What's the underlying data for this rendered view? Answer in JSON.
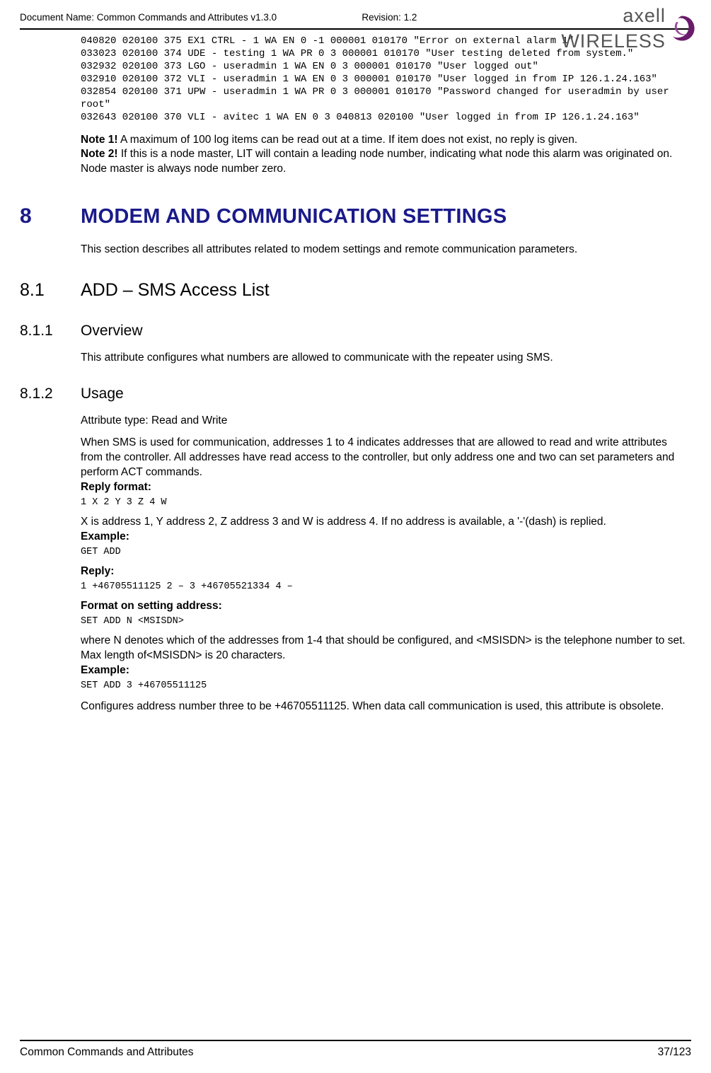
{
  "header": {
    "doc_name": "Document Name: Common Commands and Attributes v1.3.0",
    "revision": "Revision: 1.2",
    "logo_brand": "axell",
    "logo_sub": "WIRELESS"
  },
  "code_block": "040820 020100 375 EX1 CTRL - 1 WA EN 0 -1 000001 010170 \"Error on external alarm 1\"\n033023 020100 374 UDE - testing 1 WA PR 0 3 000001 010170 \"User testing deleted from system.\"\n032932 020100 373 LGO - useradmin 1 WA EN 0 3 000001 010170 \"User logged out\"\n032910 020100 372 VLI - useradmin 1 WA EN 0 3 000001 010170 \"User logged in from IP 126.1.24.163\"\n032854 020100 371 UPW - useradmin 1 WA PR 0 3 000001 010170 \"Password changed for useradmin by user root\"\n032643 020100 370 VLI - avitec 1 WA EN 0 3 040813 020100 \"User logged in from IP 126.1.24.163\"",
  "notes": {
    "note1_label": "Note 1!",
    "note1_text": " A maximum of 100 log items can be read out at a time. If item does not exist, no reply is given.",
    "note2_label": "Note 2!",
    "note2_text": " If this is a  node master, LIT will contain a leading node number, indicating what node this alarm was originated on. Node master is always node number zero."
  },
  "h1": {
    "num": "8",
    "text": "MODEM AND COMMUNICATION SETTINGS"
  },
  "h1_intro": "This section describes all attributes related to modem settings and remote communication  parameters.",
  "h2": {
    "num": "8.1",
    "text": "ADD – SMS Access List"
  },
  "h3a": {
    "num": "8.1.1",
    "text": "Overview"
  },
  "overview_text": "This attribute configures what numbers are allowed to communicate with the repeater using SMS.",
  "h3b": {
    "num": "8.1.2",
    "text": "Usage"
  },
  "usage": {
    "attr_type": "Attribute type: Read and Write",
    "intro": "When SMS is used for communication, addresses 1 to 4 indicates addresses that are allowed to read and write attributes from the controller. All addresses have read access to the controller, but only address one and two can set parameters and perform ACT commands.",
    "reply_format_label": "Reply format:",
    "reply_format_code": "1 X 2 Y 3 Z 4 W",
    "reply_format_expl": "X is address 1, Y address 2, Z address 3 and W is address 4. If no address is available, a '-'(dash) is replied.",
    "example_label": "Example:",
    "example_code": "GET ADD",
    "reply_label": "Reply:",
    "reply_code": "1 +46705511125 2 – 3 +46705521334 4 –",
    "format_set_label": "Format on setting address:",
    "format_set_code": "SET ADD N <MSISDN>",
    "format_set_expl": "where N denotes which of the addresses from 1-4 that should be configured, and <MSISDN> is the telephone number to set. Max length of<MSISDN> is 20 characters.",
    "example2_label": "Example:",
    "example2_code": "SET ADD 3 +46705511125",
    "final": "Configures address number three to be +46705511125. When data call communication is used, this attribute is obsolete."
  },
  "footer": {
    "left": "Common Commands and Attributes",
    "right": "37/123"
  }
}
